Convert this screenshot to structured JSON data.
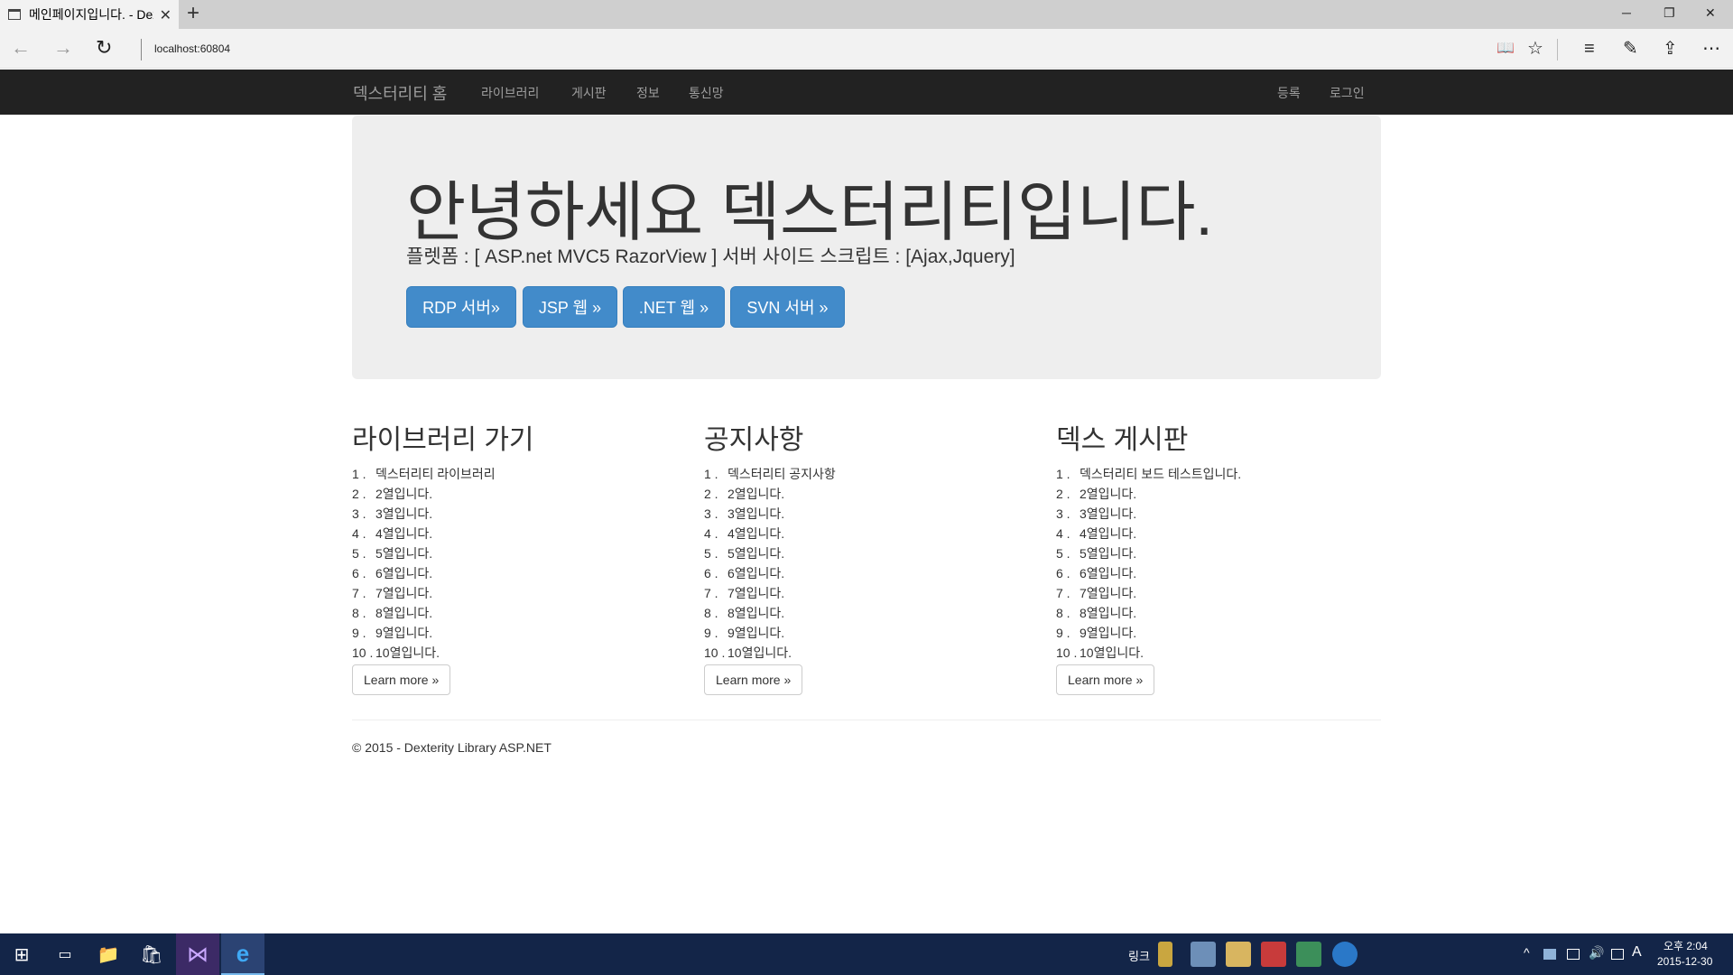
{
  "browser": {
    "tab_title": "메인페이지입니다. - Dexterity",
    "url": "localhost:60804",
    "close_glyph": "✕",
    "new_tab_glyph": "+",
    "window_controls": {
      "minimize": "─",
      "restore": "❐",
      "close": "✕"
    },
    "nav": {
      "back": "←",
      "forward": "→",
      "refresh": "↻"
    },
    "tools": {
      "reading": "📖",
      "favorite": "☆",
      "hub": "≡",
      "note": "✎",
      "share": "⇪",
      "more": "⋯"
    }
  },
  "navbar": {
    "brand": "덱스터리티 홈",
    "links": [
      "라이브러리",
      "게시판",
      "정보",
      "통신망"
    ],
    "right_links": [
      "등록",
      "로그인"
    ]
  },
  "jumbotron": {
    "title": "안녕하세요 덱스터리티입니다.",
    "lead": "플렛폼 : [ ASP.net MVC5 RazorView ] 서버 사이드 스크립트 : [Ajax,Jquery]",
    "buttons": [
      "RDP 서버»",
      "JSP 웹 »",
      ".NET 웹 »",
      "SVN 서버 »"
    ],
    "button_color": "#428bca"
  },
  "columns": [
    {
      "heading": "라이브러리 가기",
      "items": [
        "덱스터리티 라이브러리",
        "2열입니다.",
        "3열입니다.",
        "4열입니다.",
        "5열입니다.",
        "6열입니다.",
        "7열입니다.",
        "8열입니다.",
        "9열입니다.",
        "10열입니다."
      ],
      "button": "Learn more »"
    },
    {
      "heading": "공지사항",
      "items": [
        "덱스터리티 공지사항",
        "2열입니다.",
        "3열입니다.",
        "4열입니다.",
        "5열입니다.",
        "6열입니다.",
        "7열입니다.",
        "8열입니다.",
        "9열입니다.",
        "10열입니다."
      ],
      "button": "Learn more »"
    },
    {
      "heading": "덱스 게시판",
      "items": [
        "덱스터리티 보드 테스트입니다.",
        "2열입니다.",
        "3열입니다.",
        "4열입니다.",
        "5열입니다.",
        "6열입니다.",
        "7열입니다.",
        "8열입니다.",
        "9열입니다.",
        "10열입니다."
      ],
      "button": "Learn more »"
    }
  ],
  "numbers": [
    "1 .",
    "2 .",
    "3 .",
    "4 .",
    "5 .",
    "6 .",
    "7 .",
    "8 .",
    "9 .",
    "10 ."
  ],
  "footer": "© 2015 - Dexterity Library ASP.NET",
  "taskbar": {
    "links_label": "링크",
    "clock_time": "오후 2:04",
    "clock_date": "2015-12-30",
    "ime": "A",
    "start_glyph": "⊞",
    "taskview_glyph": "▭",
    "edge_glyph": "e",
    "vs_glyph": "⋈",
    "explorer_glyph": "📁",
    "store_glyph": "🛍",
    "tray_up": "^"
  }
}
